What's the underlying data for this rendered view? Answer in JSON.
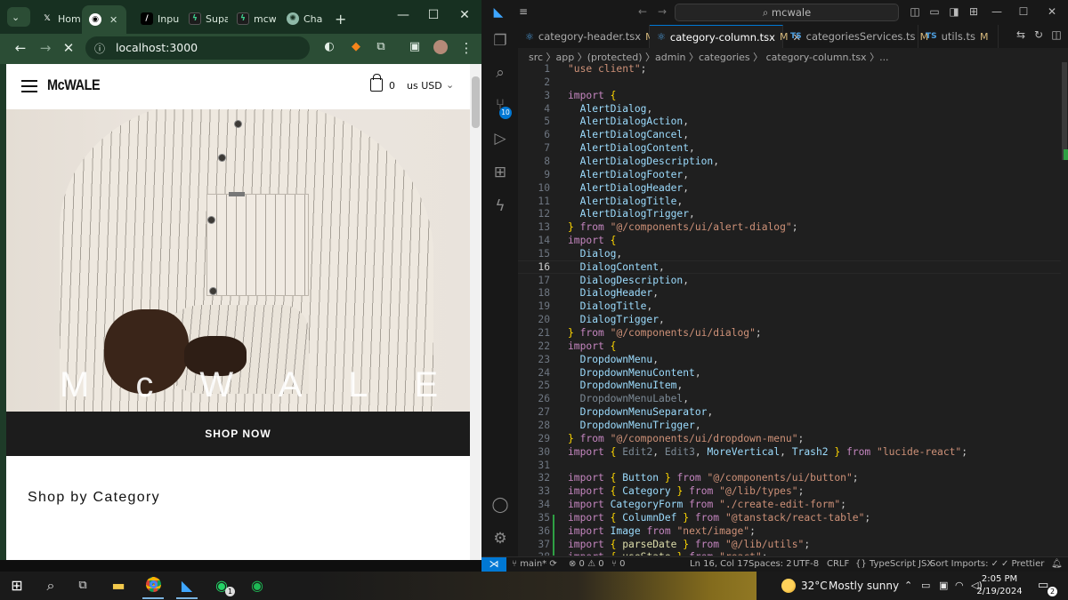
{
  "browser": {
    "tabs": [
      {
        "label": "Hom",
        "icon": "x-logo-icon"
      },
      {
        "label": "",
        "icon": "eye-icon"
      },
      {
        "label": "Inpu",
        "icon": "slash-icon"
      },
      {
        "label": "Supa",
        "icon": "supabase-icon"
      },
      {
        "label": "mcw",
        "icon": "supabase-icon"
      },
      {
        "label": "Cha",
        "icon": "chatgpt-icon"
      }
    ],
    "new_tab": "+",
    "url": "localhost:3000"
  },
  "site": {
    "logo": "McWALE",
    "cart_count": "0",
    "currency": "us USD",
    "hero_word": "McWALE",
    "shop_now": "SHOP NOW",
    "section_title": "Shop by Category"
  },
  "vscode": {
    "search": "mcwale",
    "tabs": [
      {
        "label": "category-header.tsx",
        "mod": "M"
      },
      {
        "label": "category-column.tsx",
        "mod": "M"
      },
      {
        "label": "categoriesServices.ts",
        "mod": "M"
      },
      {
        "label": "utils.ts",
        "mod": "M"
      }
    ],
    "breadcrumb": "src 〉app 〉(protected) 〉admin 〉categories 〉 category-column.tsx 〉...",
    "source_control_badge": "10",
    "current_line": 16,
    "status": {
      "branch": "main*",
      "problems": "⊗ 0 ⚠ 0",
      "ports": "⑂ 0",
      "position": "Ln 16, Col 17",
      "spaces": "Spaces: 2",
      "encoding": "UTF-8",
      "eol": "CRLF",
      "language": "{} TypeScript JSX",
      "sort_imports": "Sort Imports: ✓",
      "prettier": "✓ Prettier"
    }
  },
  "taskbar": {
    "weather_temp": "32°C",
    "weather_cond": "Mostly sunny",
    "time": "2:05 PM",
    "date": "2/19/2024",
    "notifications": "2",
    "whatsapp_badge": "1"
  },
  "colors": {
    "chrome_frame": "#1e3b28",
    "vs_accent": "#0078d4",
    "shop_now_bg": "#1c1c1c"
  }
}
